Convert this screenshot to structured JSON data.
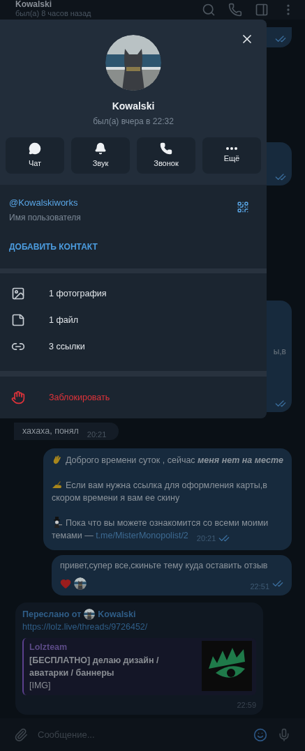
{
  "header": {
    "name": "Kowalski",
    "status": "был(а) 8 часов назад"
  },
  "background_fragment": "ы,в",
  "messages": [
    {
      "kind": "incoming",
      "text": "хахаха, понял",
      "time": "20:21"
    },
    {
      "kind": "outgoing",
      "read": true,
      "time": "20:21",
      "paragraphs": [
        {
          "text": "Доброго времени суток , сейчас **меня нет на месте**"
        },
        {
          "text": "Если вам нужна ссылка для оформления карты,в скором времени я вам ее скину"
        },
        {
          "text": "Пока что вы можете ознакомится со всеми моими темами —",
          "link": "t.me/MisterMonopolist/2"
        }
      ]
    },
    {
      "kind": "outgoing",
      "read": true,
      "reacted": true,
      "time": "22:51",
      "text": "привет,супер все,скиньте тему куда оставить отзыв"
    },
    {
      "kind": "forwarded",
      "forwarded_label": "Переслано от",
      "forwarded_from": "Kowalski",
      "link": "https://lolz.live/threads/9726452/",
      "preview": {
        "site": "Lolzteam",
        "title": "[БЕСПЛАТНО] делаю дизайн / аватарки / баннеры",
        "description": "[IMG]"
      },
      "time": "22:59"
    }
  ],
  "composer": {
    "placeholder": "Сообщение..."
  },
  "profile": {
    "name": "Kowalski",
    "status": "был(а) вчера в 22:32",
    "actions": [
      {
        "label": "Чат"
      },
      {
        "label": "Звук"
      },
      {
        "label": "Звонок"
      },
      {
        "label": "Ещё"
      }
    ],
    "username": "@Kowalskiworks",
    "username_caption": "Имя пользователя",
    "add_contact": "ДОБАВИТЬ КОНТАКТ",
    "media": [
      {
        "label": "1 фотография"
      },
      {
        "label": "1 файл"
      },
      {
        "label": "3 ссылки"
      }
    ],
    "block": "Заблокировать"
  }
}
